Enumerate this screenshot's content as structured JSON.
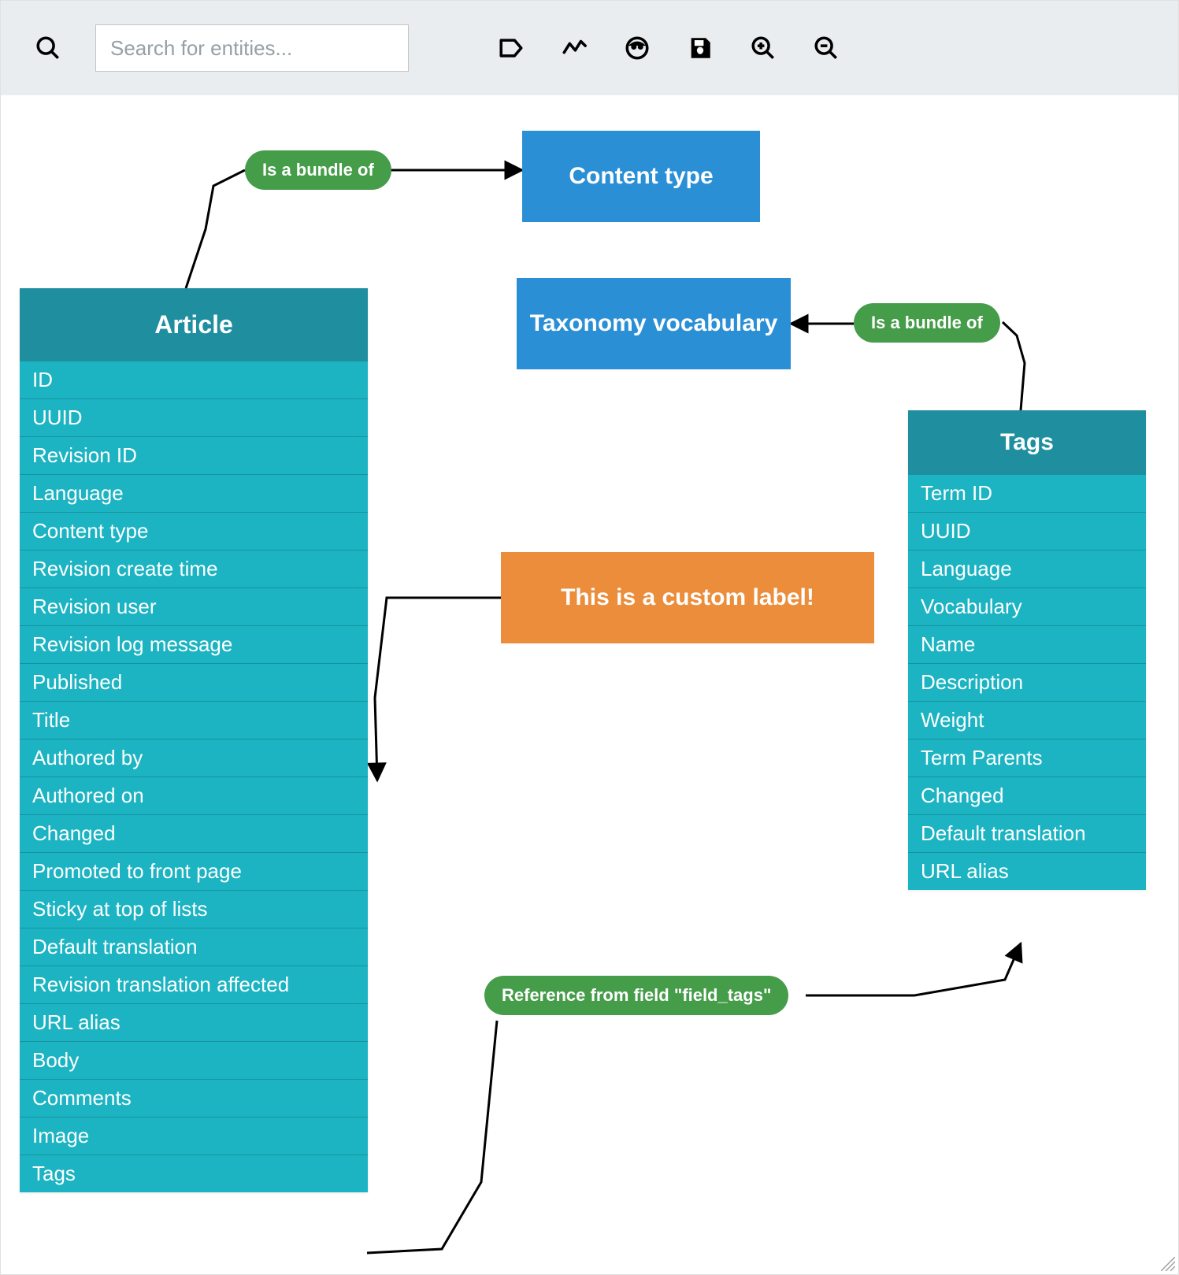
{
  "toolbar": {
    "search_placeholder": "Search for entities..."
  },
  "nodes": {
    "content_type": {
      "label": "Content type"
    },
    "taxonomy_vocabulary": {
      "label": "Taxonomy vocabulary"
    },
    "custom_label": {
      "label": "This is a custom label!"
    }
  },
  "entities": {
    "article": {
      "title": "Article",
      "fields": [
        "ID",
        "UUID",
        "Revision ID",
        "Language",
        "Content type",
        "Revision create time",
        "Revision user",
        "Revision log message",
        "Published",
        "Title",
        "Authored by",
        "Authored on",
        "Changed",
        "Promoted to front page",
        "Sticky at top of lists",
        "Default translation",
        "Revision translation affected",
        "URL alias",
        "Body",
        "Comments",
        "Image",
        "Tags"
      ]
    },
    "tags": {
      "title": "Tags",
      "fields": [
        "Term ID",
        "UUID",
        "Language",
        "Vocabulary",
        "Name",
        "Description",
        "Weight",
        "Term Parents",
        "Changed",
        "Default translation",
        "URL alias"
      ]
    }
  },
  "relations": {
    "bundle_of_1": {
      "label": "Is a bundle of"
    },
    "bundle_of_2": {
      "label": "Is a bundle of"
    },
    "reference_tags": {
      "label": "Reference from field \"field_tags\""
    }
  }
}
